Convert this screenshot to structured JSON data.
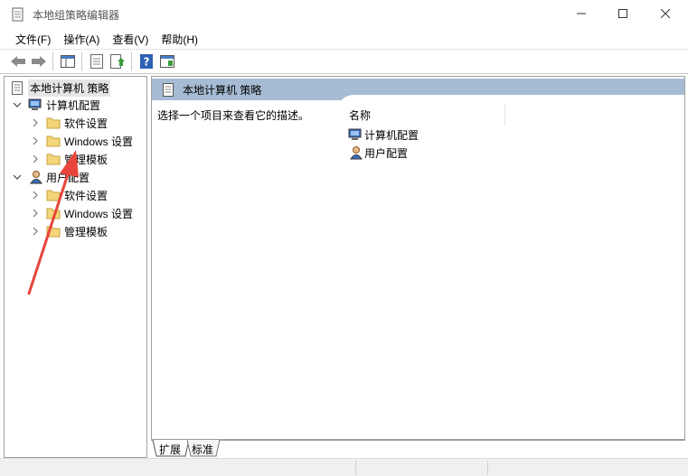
{
  "window": {
    "title": "本地组策略编辑器"
  },
  "menu": {
    "items": [
      {
        "label": "文件(F)"
      },
      {
        "label": "操作(A)"
      },
      {
        "label": "查看(V)"
      },
      {
        "label": "帮助(H)"
      }
    ]
  },
  "toolbar": {
    "buttons": [
      "back-icon",
      "forward-icon",
      "show-tree-icon",
      "properties-icon",
      "export-list-icon",
      "help-icon",
      "view-icon"
    ]
  },
  "tree": {
    "root": "本地计算机 策略",
    "computer_config": "计算机配置",
    "computer_children": [
      "软件设置",
      "Windows 设置",
      "管理模板"
    ],
    "user_config": "用户配置",
    "user_children": [
      "软件设置",
      "Windows 设置",
      "管理模板"
    ]
  },
  "right": {
    "header": "本地计算机 策略",
    "description": "选择一个项目来查看它的描述。",
    "column_name": "名称",
    "rows": [
      "计算机配置",
      "用户配置"
    ]
  },
  "tabs": {
    "extended": "扩展",
    "standard": "标准"
  },
  "colors": {
    "header_bg": "#a6bcd5",
    "annotation_arrow": "#e8453c",
    "folder": "#f3d57a"
  }
}
